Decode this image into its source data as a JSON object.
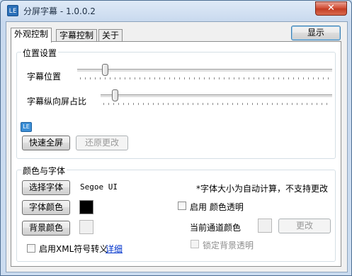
{
  "window": {
    "title": "分屏字幕 - 1.0.0.2",
    "app_icon_text": "LE",
    "close_symbol": "✕"
  },
  "tabs": [
    {
      "label": "外观控制",
      "active": true
    },
    {
      "label": "字幕控制",
      "active": false
    },
    {
      "label": "关于",
      "active": false
    }
  ],
  "header": {
    "show_button": "显示"
  },
  "position_group": {
    "title": "位置设置",
    "subtitle_position_label": "字幕位置",
    "subtitle_position_value": 0.1,
    "vertical_ratio_label": "字幕纵向屏占比",
    "vertical_ratio_value": 0.05,
    "corner_icon_text": "LE",
    "fullscreen_button": "快速全屏",
    "restore_button": "还原更改"
  },
  "color_font_group": {
    "title": "颜色与字体",
    "choose_font_button": "选择字体",
    "font_name": "Segoe UI",
    "font_note": "*字体大小为自动计算，不支持更改",
    "font_color_button": "字体颜色",
    "font_color": "#000000",
    "bg_color_button": "背景颜色",
    "bg_color": "#f0f0f0",
    "enable_transparent_label": "启用  颜色透明",
    "current_channel_label": "当前通道颜色",
    "change_button": "更改",
    "lock_bg_label": "锁定背景透明",
    "enable_xml_label": "启用XML符号转义",
    "details_link": "详细"
  }
}
